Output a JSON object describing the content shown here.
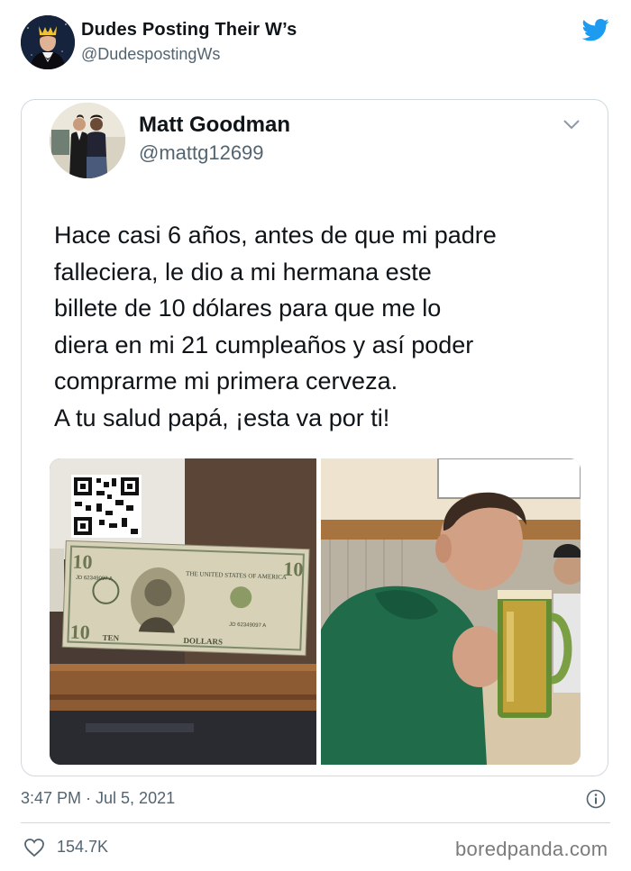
{
  "account": {
    "name": "Dudes Posting Their W’s",
    "handle": "@DudespostingWs"
  },
  "quoted_tweet": {
    "author_name": "Matt Goodman",
    "author_handle": "@mattg12699",
    "text": "Hace casi 6 años, antes de que mi padre\nfalleciera, le dio a mi hermana este\nbillete de 10 dólares para que me lo\ndiera en mi 21 cumpleaños y así poder\ncomprarme mi primera cerveza.\nA tu salud papá, ¡esta va por ti!",
    "photos": [
      {
        "label": "ten-dollar-bill",
        "bill_top_text": "THE UNITED STATES OF AMERICA",
        "serial": "JD 62349097 A",
        "denomination": "TEN",
        "bottom_text": "DOLLARS",
        "corner_value": "10"
      },
      {
        "label": "young-man-drinking-beer"
      }
    ]
  },
  "meta": {
    "timestamp": "3:47 PM · Jul 5, 2021",
    "likes": "154.7K"
  },
  "watermark": "boredpanda.com",
  "colors": {
    "twitter_blue": "#1d9bf0",
    "muted_text": "#536471",
    "border": "#cfd9de"
  },
  "icons": [
    "twitter-bird-icon",
    "chevron-down-icon",
    "info-icon",
    "heart-icon"
  ]
}
